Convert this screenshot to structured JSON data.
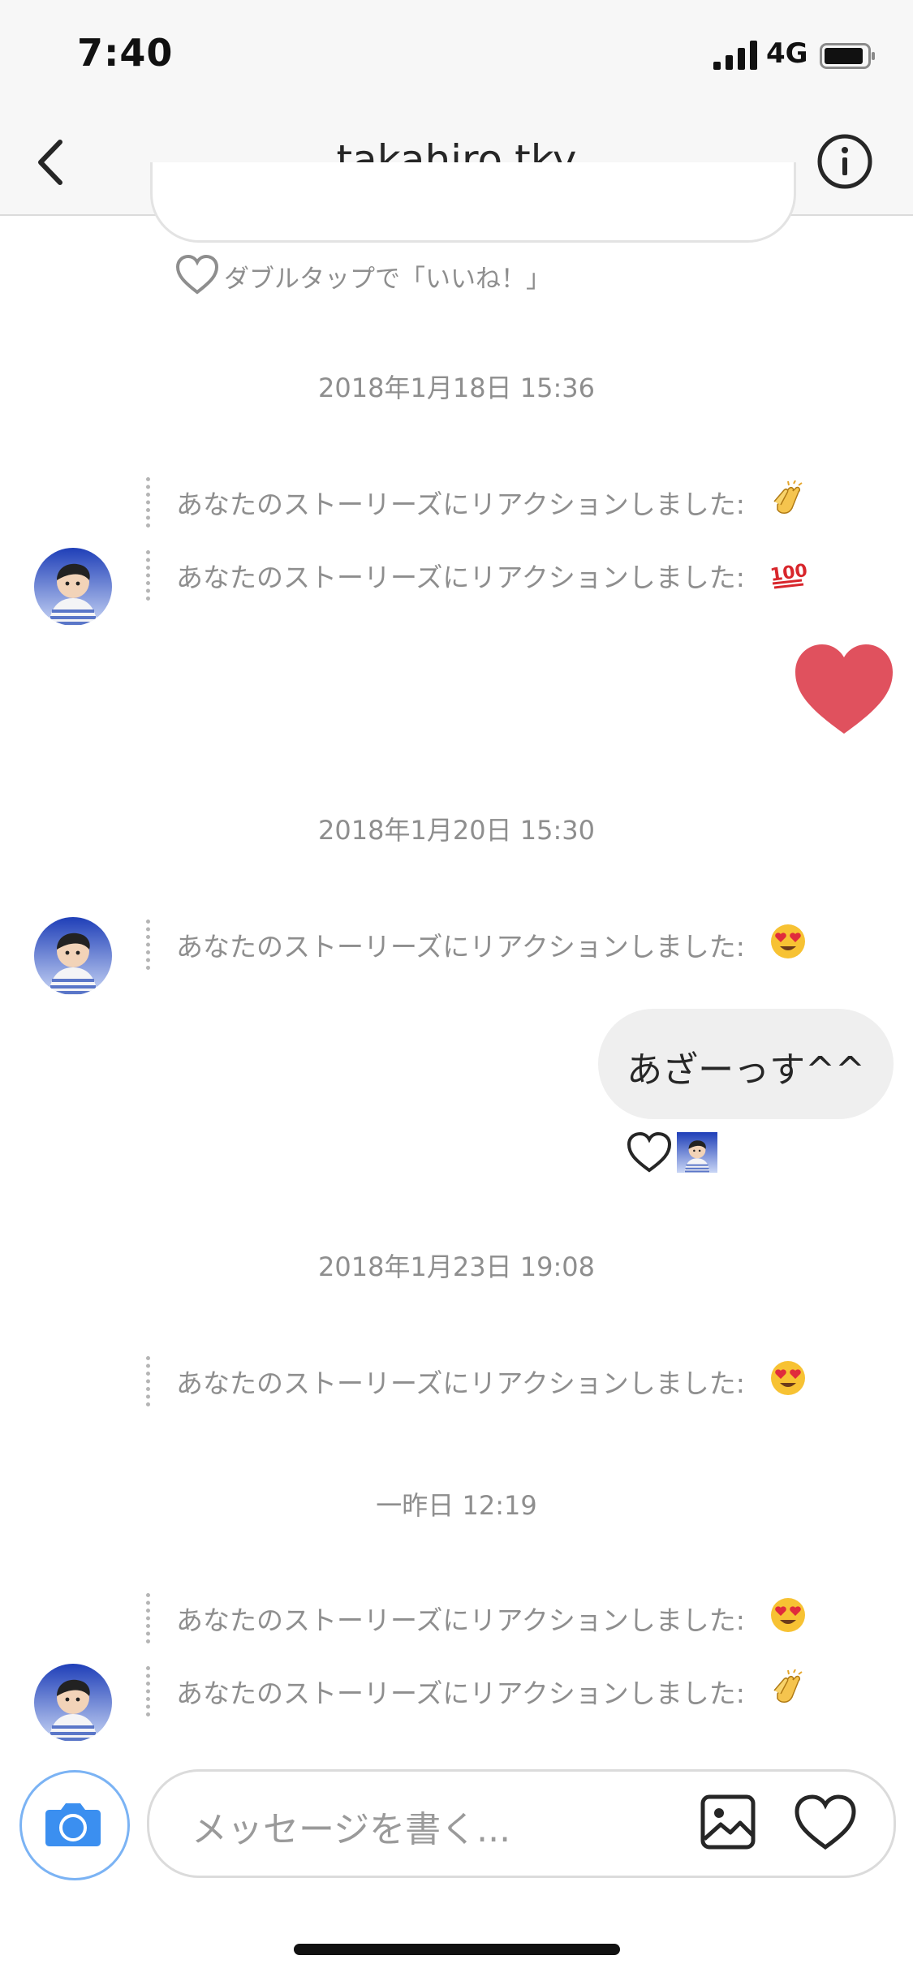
{
  "status": {
    "time": "7:40",
    "network": "4G"
  },
  "header": {
    "title": "takahiro.tky"
  },
  "double_tap_hint": "ダブルタップで「いいね！」",
  "messages": {
    "ts1": "2018年1月18日 15:36",
    "ts2": "2018年1月20日 15:30",
    "ts3": "2018年1月23日 19:08",
    "ts4": "一昨日 12:19",
    "reaction_text": "あなたのストーリーズにリアクションしました:",
    "my_message": "あざーっす^^"
  },
  "reactions": {
    "r1": "clapping-hands",
    "r2": "hundred-points",
    "r3": "heart-eyes",
    "r4": "heart-eyes",
    "r5": "heart-eyes",
    "r6": "clapping-hands"
  },
  "composer": {
    "placeholder": "メッセージを書く..."
  },
  "colors": {
    "accent_blue": "#3897f0",
    "heart_red": "#e0515e",
    "bubble_gray": "#efefef"
  }
}
